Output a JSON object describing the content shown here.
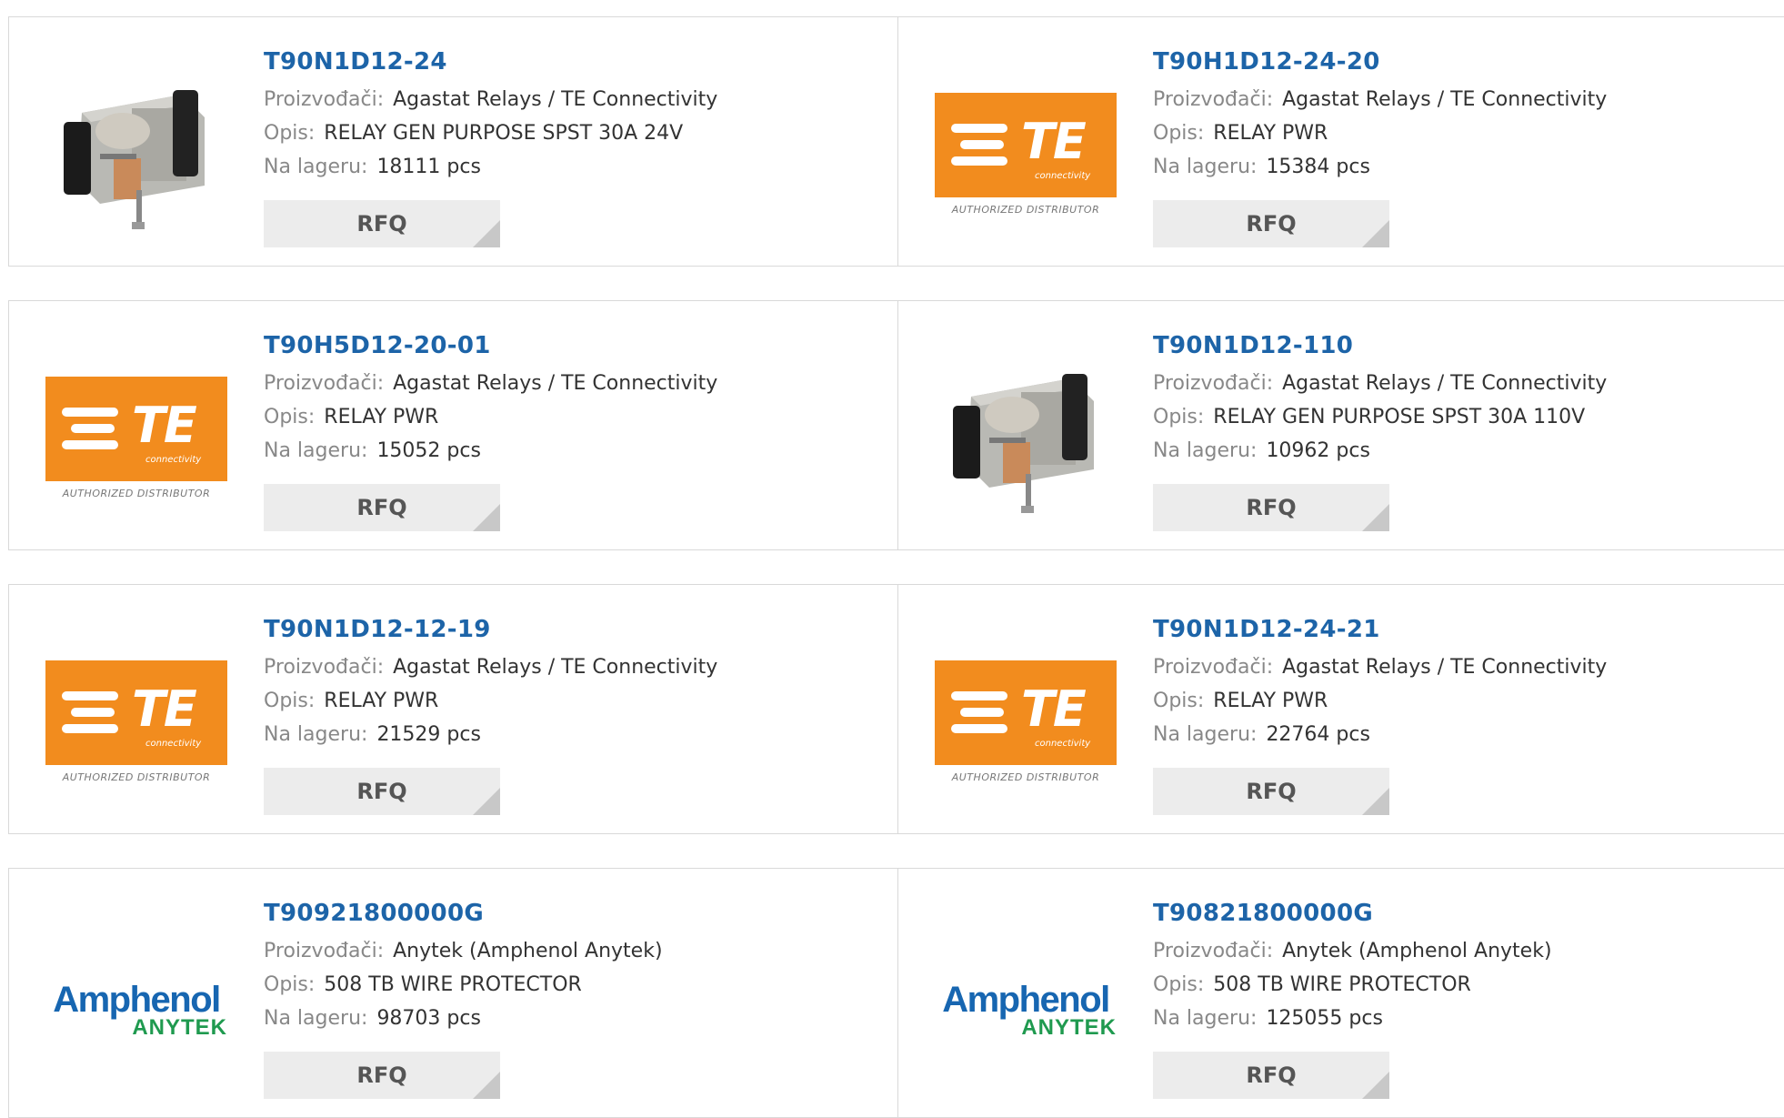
{
  "labels": {
    "manufacturer": "Proizvođači:",
    "description": "Opis:",
    "stock": "Na lageru:",
    "rfq": "RFQ"
  },
  "products": [
    {
      "part": "T90N1D12-24",
      "manufacturer": "Agastat Relays / TE Connectivity",
      "description": "RELAY GEN PURPOSE SPST 30A 24V",
      "stock": "18111 pcs",
      "image": "relay-photo"
    },
    {
      "part": "T90H1D12-24-20",
      "manufacturer": "Agastat Relays / TE Connectivity",
      "description": "RELAY PWR",
      "stock": "15384 pcs",
      "image": "te-logo"
    },
    {
      "part": "T90H5D12-20-01",
      "manufacturer": "Agastat Relays / TE Connectivity",
      "description": "RELAY PWR",
      "stock": "15052 pcs",
      "image": "te-logo"
    },
    {
      "part": "T90N1D12-110",
      "manufacturer": "Agastat Relays / TE Connectivity",
      "description": "RELAY GEN PURPOSE SPST 30A 110V",
      "stock": "10962 pcs",
      "image": "relay-photo"
    },
    {
      "part": "T90N1D12-12-19",
      "manufacturer": "Agastat Relays / TE Connectivity",
      "description": "RELAY PWR",
      "stock": "21529 pcs",
      "image": "te-logo"
    },
    {
      "part": "T90N1D12-24-21",
      "manufacturer": "Agastat Relays / TE Connectivity",
      "description": "RELAY PWR",
      "stock": "22764 pcs",
      "image": "te-logo"
    },
    {
      "part": "T90921800000G",
      "manufacturer": "Anytek (Amphenol Anytek)",
      "description": "508 TB WIRE PROTECTOR",
      "stock": "98703 pcs",
      "image": "amphenol-logo"
    },
    {
      "part": "T90821800000G",
      "manufacturer": "Anytek (Amphenol Anytek)",
      "description": "508 TB WIRE PROTECTOR",
      "stock": "125055 pcs",
      "image": "amphenol-logo"
    }
  ],
  "logos": {
    "te": {
      "letters": "TE",
      "sub": "connectivity",
      "tagline": "AUTHORIZED DISTRIBUTOR"
    },
    "amphenol": {
      "line1": "Amphenol",
      "line2": "ANYTEK"
    }
  },
  "colors": {
    "link": "#1d64a8",
    "te_orange": "#f28c1e",
    "amphenol_blue": "#1766b1",
    "anytek_green": "#1f9a4f",
    "rfq_bg": "#ececec"
  }
}
